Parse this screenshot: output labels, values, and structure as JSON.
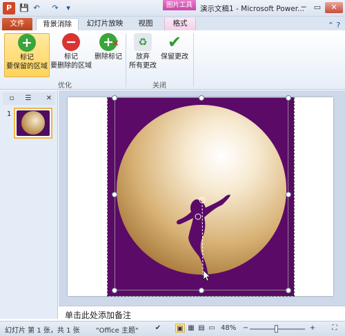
{
  "app": {
    "icon_letter": "P",
    "title": "演示文稿1 - Microsoft Power...",
    "context_tab": "图片工具"
  },
  "quick_access": {
    "save": "💾",
    "undo": "↶",
    "redo": "↷",
    "customize": "▾"
  },
  "window_controls": {
    "minimize": "─",
    "maximize": "▭",
    "close": "✕"
  },
  "tabs": {
    "file": "文件",
    "background_removal": "背景消除",
    "slideshow": "幻灯片放映",
    "view": "视图",
    "format": "格式",
    "help": "⌃ ?"
  },
  "ribbon": {
    "keep_btn": {
      "line1": "标记",
      "line2": "要保留的区域"
    },
    "remove_btn": {
      "line1": "标记",
      "line2": "要删除的区域"
    },
    "delete_mark_btn": {
      "line1": "删除标记"
    },
    "discard_btn": {
      "line1": "放弃",
      "line2": "所有更改"
    },
    "keep_changes_btn": {
      "line1": "保留更改"
    },
    "group_optimize": "优化",
    "group_close": "关闭"
  },
  "slide_panel": {
    "slide_number": "1",
    "close": "✕"
  },
  "notes": {
    "placeholder": "单击此处添加备注"
  },
  "status": {
    "slide": "幻灯片 第 1 张，共 1 张",
    "theme": "\"Office 主题\"",
    "zoom": "48%",
    "zoom_minus": "−",
    "zoom_plus": "+"
  },
  "colors": {
    "picture_bg": "#5b0a67",
    "file_tab": "#c84b24",
    "context_tab": "#d45bb5"
  }
}
